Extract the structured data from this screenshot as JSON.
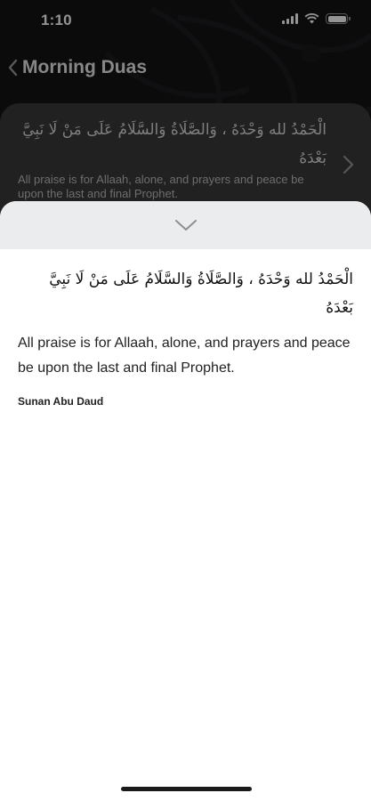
{
  "status_bar": {
    "time": "1:10"
  },
  "nav": {
    "back_icon": "chevron-left-icon",
    "title": "Morning Duas"
  },
  "dua_card": {
    "arabic": "الْحَمْدُ لله وَحْدَهُ ، وَالصَّلَاةُ وَالسَّلَامُ عَلَى مَنْ لَا نَبِيَّ بَعْدَهُ",
    "english": "All praise is for Allaah, alone, and prayers and peace be upon the last and final Prophet.",
    "next_icon": "chevron-right-icon"
  },
  "sheet": {
    "collapse_icon": "chevron-down-icon",
    "arabic": "الْحَمْدُ لله وَحْدَهُ ، وَالصَّلَاةُ وَالسَّلَامُ عَلَى مَنْ لَا نَبِيَّ بَعْدَهُ",
    "english": "All praise is for Allaah, alone, and prayers and peace be upon the last and final Prophet.",
    "source": "Sunan Abu Daud"
  },
  "colors": {
    "background": "#131416",
    "card": "#3a3a3c",
    "sheet": "#ffffff",
    "sheet_header": "#ebeced"
  }
}
